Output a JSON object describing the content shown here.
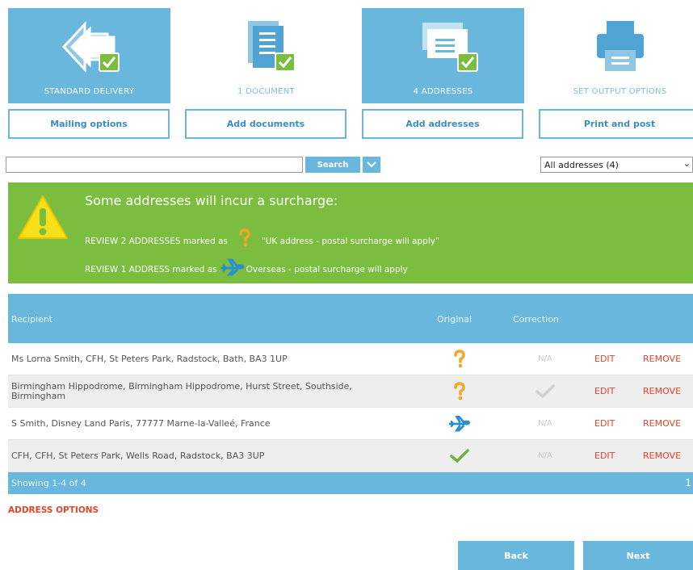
{
  "steps": [
    {
      "label": "STANDARD DELIVERY",
      "button": "Mailing options",
      "state": "complete"
    },
    {
      "label": "1 DOCUMENT",
      "button": "Add documents",
      "state": "complete"
    },
    {
      "label": "4 ADDRESSES",
      "button": "Add addresses",
      "state": "complete"
    },
    {
      "label": "SET OUTPUT OPTIONS",
      "button": "Print and post",
      "state": "pending"
    }
  ],
  "search": {
    "value": "",
    "button_label": "Search"
  },
  "filter": {
    "selected": "All addresses (4)"
  },
  "banner": {
    "title": "Some addresses will incur a surcharge:",
    "line1_prefix": "REVIEW 2 ADDRESSES marked as",
    "line1_suffix": "\"UK address - postal surcharge will apply\"",
    "line2_prefix": "REVIEW 1 ADDRESS marked as",
    "line2_suffix": "Overseas - postal surcharge will apply"
  },
  "table": {
    "headers": {
      "recipient": "Recipient",
      "original": "Original",
      "correction": "Correction"
    },
    "rows": [
      {
        "recipient": "Ms Lorna Smith, CFH, St Peters Park, Radstock, Bath, BA3 1UP",
        "original": "question-icon",
        "correction": "N/A",
        "edit": "EDIT",
        "remove": "REMOVE"
      },
      {
        "recipient": "Birmingham Hippodrome, Birmingham Hippodrome, Hurst Street, Southside, Birmingham",
        "original": "question-icon",
        "correction": "check-icon",
        "edit": "EDIT",
        "remove": "REMOVE"
      },
      {
        "recipient": "S Smith, Disney Land Paris, 77777 Marne-la-Valleé, France",
        "original": "plane-icon",
        "correction": "N/A",
        "edit": "EDIT",
        "remove": "REMOVE"
      },
      {
        "recipient": "CFH, CFH, St Peters Park, Wells Road, Radstock, BA3 3UP",
        "original": "check-icon",
        "correction": "N/A",
        "edit": "EDIT",
        "remove": "REMOVE"
      }
    ],
    "footer": {
      "showing": "Showing 1-4 of 4",
      "page": "1"
    }
  },
  "address_options": "ADDRESS OPTIONS",
  "nav": {
    "back": "Back",
    "next": "Next"
  },
  "colors": {
    "accent": "#6ab7dd",
    "banner": "#7bbd3f",
    "link": "#e2442b",
    "warning": "#f5a623"
  }
}
